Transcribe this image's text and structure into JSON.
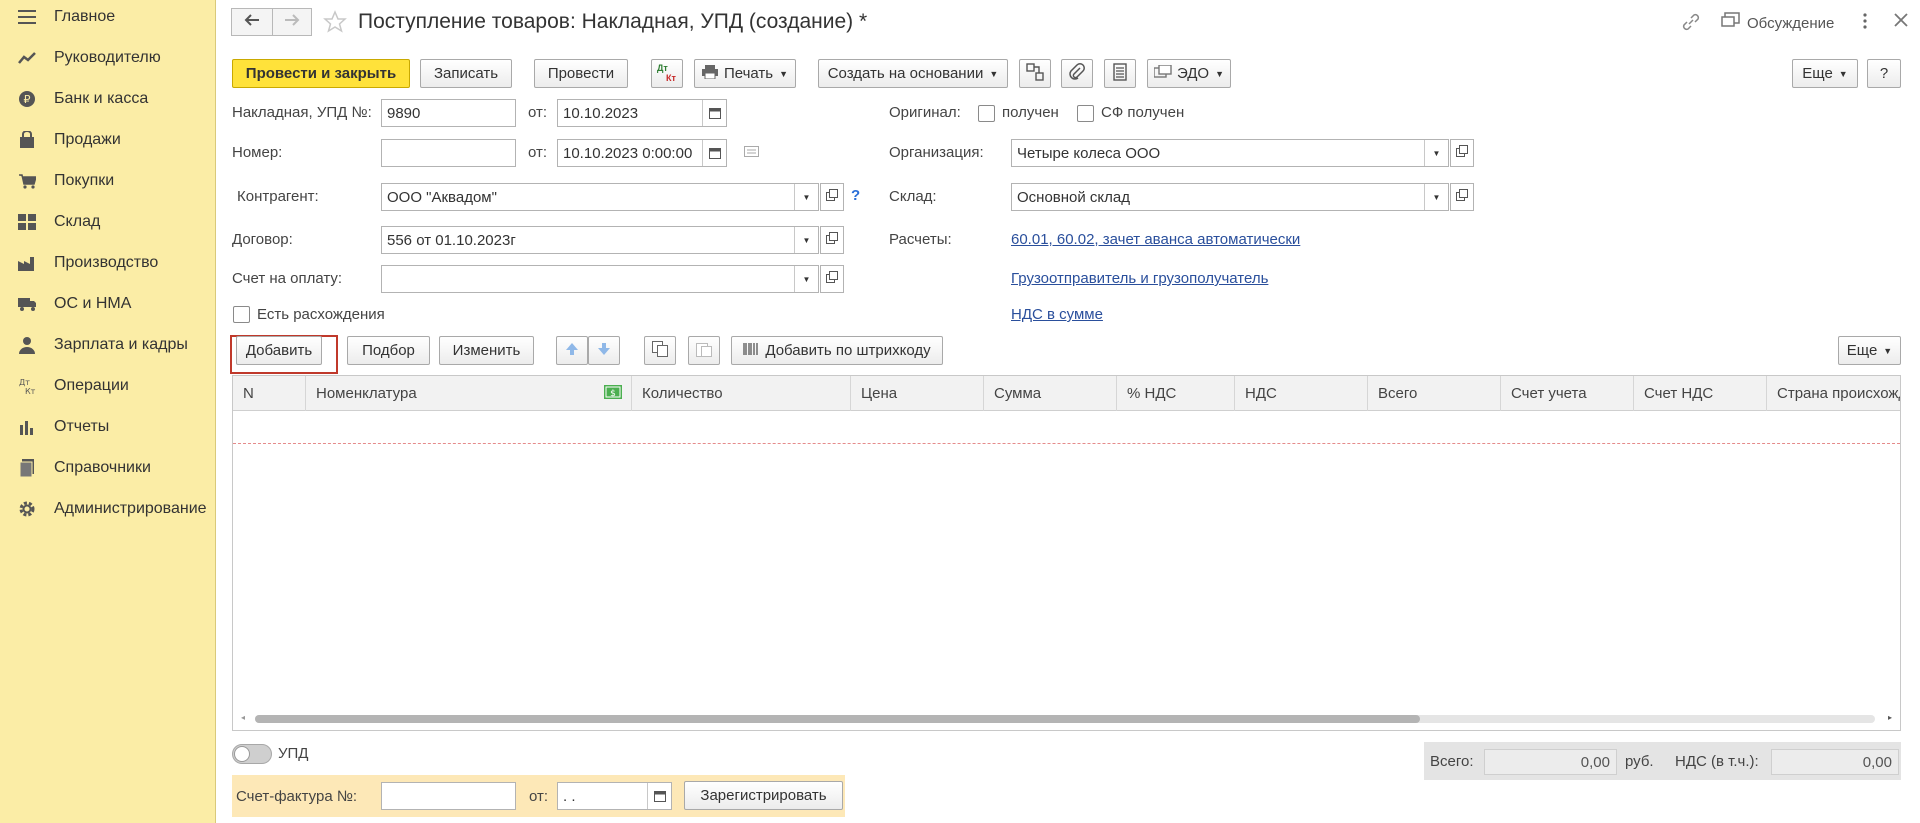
{
  "sidebar": {
    "items": [
      {
        "label": "Главное",
        "icon": "menu-icon"
      },
      {
        "label": "Руководителю",
        "icon": "trend-icon"
      },
      {
        "label": "Банк и касса",
        "icon": "ruble-icon"
      },
      {
        "label": "Продажи",
        "icon": "bag-icon"
      },
      {
        "label": "Покупки",
        "icon": "cart-icon"
      },
      {
        "label": "Склад",
        "icon": "warehouse-icon"
      },
      {
        "label": "Производство",
        "icon": "factory-icon"
      },
      {
        "label": "ОС и НМА",
        "icon": "truck-icon"
      },
      {
        "label": "Зарплата и кадры",
        "icon": "person-icon"
      },
      {
        "label": "Операции",
        "icon": "dt-kt-icon"
      },
      {
        "label": "Отчеты",
        "icon": "bar-chart-icon"
      },
      {
        "label": "Справочники",
        "icon": "book-icon"
      },
      {
        "label": "Администрирование",
        "icon": "gear-icon"
      }
    ]
  },
  "header": {
    "title": "Поступление товаров: Накладная, УПД (создание) *",
    "discussion": "Обсуждение"
  },
  "toolbar": {
    "post_close": "Провести и закрыть",
    "save": "Записать",
    "post": "Провести",
    "dtkt_top": "Дт",
    "dtkt_bottom": "Кт",
    "print": "Печать",
    "create_based": "Создать на основании",
    "edo": "ЭДО",
    "more": "Еще",
    "help": "?"
  },
  "form": {
    "invoice_label": "Накладная, УПД №:",
    "invoice_number": "9890",
    "from_label": "от:",
    "invoice_date": "10.10.2023",
    "number_label": "Номер:",
    "number_value": "",
    "number_date": "10.10.2023  0:00:00",
    "counterparty_label": "Контрагент:",
    "counterparty_value": "ООО \"Аквадом\"",
    "help_mark": "?",
    "contract_label": "Договор:",
    "contract_value": "556 от 01.10.2023г",
    "payment_label": "Счет на оплату:",
    "payment_value": "",
    "discrepancy_label": "Есть расхождения",
    "original_label": "Оригинал:",
    "received_label": "получен",
    "sf_received_label": "СФ получен",
    "org_label": "Организация:",
    "org_value": "Четыре колеса ООО",
    "warehouse_label": "Склад:",
    "warehouse_value": "Основной склад",
    "settlements_label": "Расчеты:",
    "settlements_link": "60.01, 60.02, зачет аванса автоматически",
    "shipper_link": "Грузоотправитель и грузополучатель",
    "vat_link": "НДС в сумме"
  },
  "table_toolbar": {
    "add": "Добавить",
    "select": "Подбор",
    "change": "Изменить",
    "barcode": "Добавить по штрихкоду",
    "more": "Еще"
  },
  "table": {
    "columns": [
      "N",
      "Номенклатура",
      "",
      "Количество",
      "Цена",
      "Сумма",
      "% НДС",
      "НДС",
      "Всего",
      "Счет учета",
      "Счет НДС",
      "Страна происхождения"
    ]
  },
  "footer": {
    "upd_label": "УПД",
    "total_label": "Всего:",
    "total_value": "0,00",
    "currency": "руб.",
    "vat_label": "НДС (в т.ч.):",
    "vat_value": "0,00",
    "sf_label": "Счет-фактура №:",
    "sf_number": "",
    "sf_from": "от:",
    "sf_date": " .  .",
    "register": "Зарегистрировать"
  },
  "colors": {
    "sidebar_bg": "#fbeda6",
    "primary_button": "#ffe23a",
    "link": "#2a4f9c",
    "highlight_border": "#c0392b"
  }
}
